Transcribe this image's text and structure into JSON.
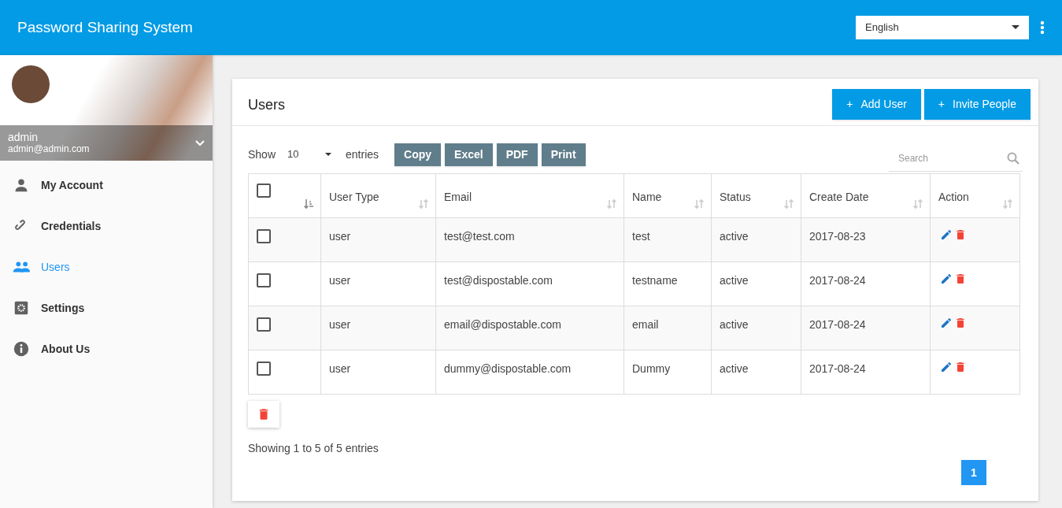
{
  "app_bar": {
    "title": "Password Sharing System",
    "language": "English"
  },
  "sidebar": {
    "profile": {
      "name": "admin",
      "email": "admin@admin.com"
    },
    "items": [
      {
        "label": "My Account",
        "selected": false
      },
      {
        "label": "Credentials",
        "selected": false
      },
      {
        "label": "Users",
        "selected": true
      },
      {
        "label": "Settings",
        "selected": false
      },
      {
        "label": "About Us",
        "selected": false
      }
    ]
  },
  "card": {
    "title": "Users",
    "actions": [
      {
        "icon": "+",
        "label": "Add User"
      },
      {
        "icon": "+",
        "label": "Invite People"
      }
    ],
    "show": {
      "before": "Show",
      "value": "10",
      "after": "entries"
    },
    "export_buttons": [
      "Copy",
      "Excel",
      "PDF",
      "Print"
    ],
    "search": {
      "placeholder": "Search"
    },
    "table": {
      "select_all": {
        "checked": false
      },
      "columns": [
        "User Type",
        "Email",
        "Name",
        "Status",
        "Create Date",
        "Action"
      ],
      "rows": [
        {
          "checked": false,
          "cells": [
            "user",
            "test@test.com",
            "test",
            "active",
            "2017-08-23"
          ]
        },
        {
          "checked": false,
          "cells": [
            "user",
            "test@dispostable.com",
            "testname",
            "active",
            "2017-08-24"
          ]
        },
        {
          "checked": false,
          "cells": [
            "user",
            "email@dispostable.com",
            "email",
            "active",
            "2017-08-24"
          ]
        },
        {
          "checked": false,
          "cells": [
            "user",
            "dummy@dispostable.com",
            "Dummy",
            "active",
            "2017-08-24"
          ]
        }
      ]
    },
    "info": "Showing 1 to 5 of 5 entries",
    "pages": [
      {
        "label": "1",
        "selected": true
      }
    ]
  }
}
